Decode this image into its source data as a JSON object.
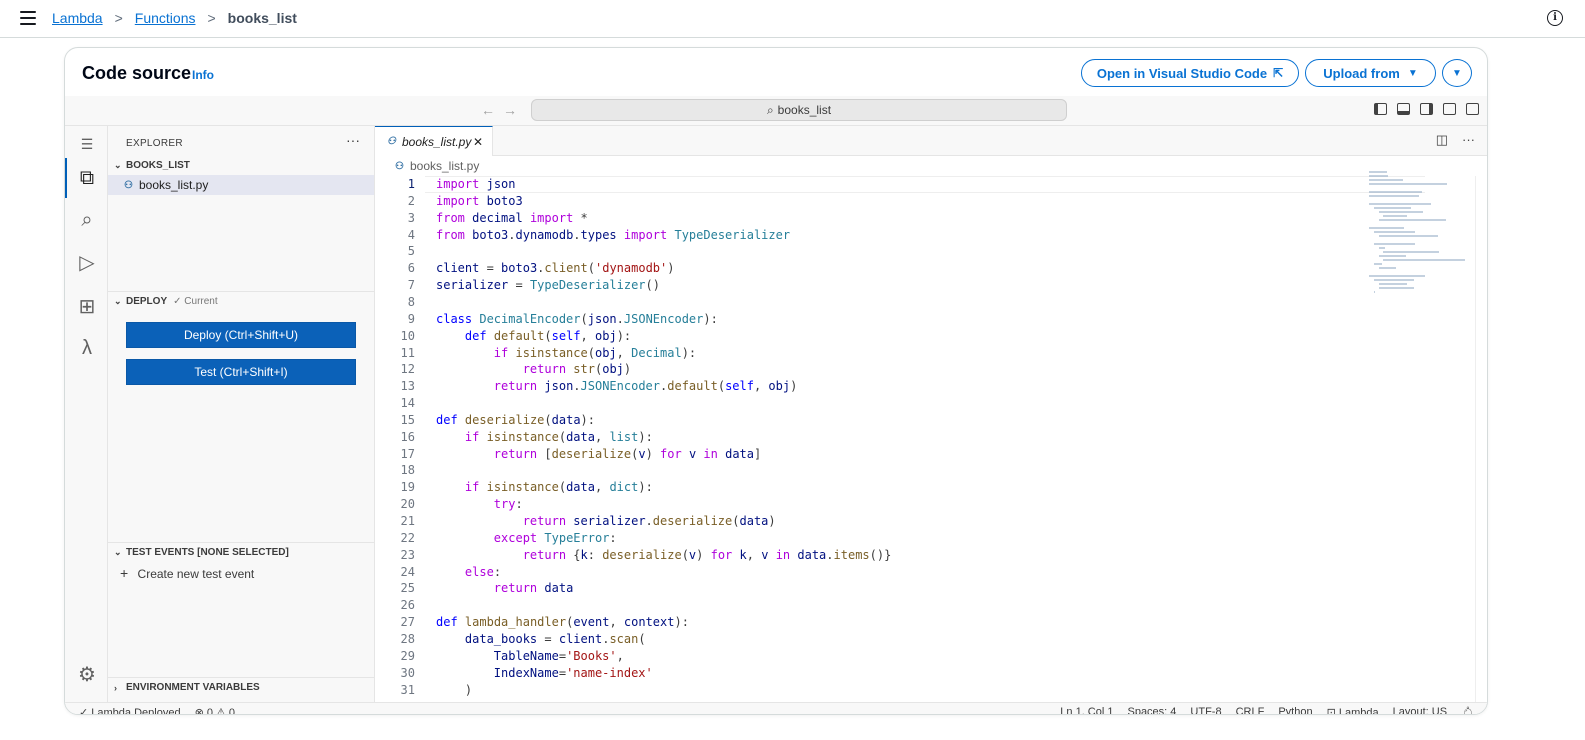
{
  "breadcrumb": {
    "items": [
      "Lambda",
      "Functions"
    ],
    "current": "books_list"
  },
  "panel": {
    "title": "Code source",
    "info": "Info",
    "open_vscode": "Open in Visual Studio Code",
    "upload_from": "Upload from"
  },
  "ide": {
    "search": "books_list",
    "explorer_title": "EXPLORER",
    "folder": "BOOKS_LIST",
    "file": "books_list.py",
    "deploy_section": "DEPLOY",
    "deploy_status": "✓ Current",
    "deploy_button": "Deploy (Ctrl+Shift+U)",
    "test_button": "Test (Ctrl+Shift+I)",
    "test_events_section": "TEST EVENTS [NONE SELECTED]",
    "create_test_event": "Create new test event",
    "env_section": "ENVIRONMENT VARIABLES",
    "tab_label": "books_list.py",
    "file_crumb": "books_list.py"
  },
  "code_lines": [
    "import json",
    "import boto3",
    "from decimal import *",
    "from boto3.dynamodb.types import TypeDeserializer",
    "",
    "client = boto3.client('dynamodb')",
    "serializer = TypeDeserializer()",
    "",
    "class DecimalEncoder(json.JSONEncoder):",
    "    def default(self, obj):",
    "        if isinstance(obj, Decimal):",
    "            return str(obj)",
    "        return json.JSONEncoder.default(self, obj)",
    "",
    "def deserialize(data):",
    "    if isinstance(data, list):",
    "        return [deserialize(v) for v in data]",
    "",
    "    if isinstance(data, dict):",
    "        try:",
    "            return serializer.deserialize(data)",
    "        except TypeError:",
    "            return {k: deserialize(v) for k, v in data.items()}",
    "    else:",
    "        return data",
    "",
    "def lambda_handler(event, context):",
    "    data_books = client.scan(",
    "        TableName='Books',",
    "        IndexName='name-index'",
    "    )"
  ],
  "status": {
    "deployed": "✓ Lambda Deployed",
    "problems": "⊗ 0 ⚠ 0",
    "position": "Ln 1, Col 1",
    "spaces": "Spaces: 4",
    "encoding": "UTF-8",
    "eol": "CRLF",
    "language": "Python",
    "runtime": "Lambda",
    "layout": "Layout: US"
  }
}
